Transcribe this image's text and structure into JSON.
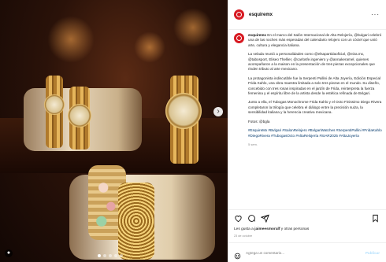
{
  "post": {
    "username": "esquiremx",
    "more_label": "···"
  },
  "caption": {
    "user": "esquiremx",
    "paragraphs": [
      "En el marco del Salón Internacional de Alta Relojería, @bulgari celebró una de las noches más esperadas del calendario relojero con un cóctel que unió arte, cultura y elegancia italiana.",
      "La velada reunió a personalidades como @elsapartidaoficial, @eiza.mx, @tabosport, Eliseo Thellier, @carlosfe.ingeniero y @annakeramel, quienes acompañaron a la maison en la presentación de tres piezas excepcionales que rinden tributo al arte mexicano.",
      "La protagonista indiscutible fue la Serpenti Pallini de Alta Joyería, Edición Especial Frida Kahlo, una obra maestra limitada a solo tres piezas en el mundo. Su diseño, concebido con tres rosas inspiradas en el jardín de Frida, reinterpreta la fuerza femenina y el espíritu libre de la artista desde la estética refinada de Bvlgari.",
      "Junto a ella, el Tubogas Monochrome Frida Kahlo y el Octo Finissimo Diego Rivera completaron la trilogía que celebra el diálogo entre la precisión suiza, la sensibilidad italiana y la herencia creativa mexicana.",
      "Fotos: @bgla"
    ],
    "hashtags": "#EsquireMx #Bvlgari #SalonRelojero #BvlgariWatches #SerpentiPallini #FridaKahlo #DiegoRivera #TubogasOcto #AltaRelojería #SIAR2025 #AltaJoyería",
    "time": "5 sem."
  },
  "actions": {
    "like_icon": "heart-icon",
    "comment_icon": "comment-icon",
    "share_icon": "send-icon",
    "save_icon": "bookmark-icon"
  },
  "likes": {
    "prefix": "Les gusta a",
    "user": "jaimeesmoralf",
    "suffix": "y otras personas"
  },
  "date": "23 de octubre",
  "comment": {
    "placeholder": "Agrega un comentario...",
    "post_label": "Publicar"
  },
  "colors": {
    "brand": "#d71921",
    "link": "#00376b",
    "post_button": "#b2dffc"
  },
  "carousel": {
    "total_slides": 5,
    "active_slide": 1
  }
}
